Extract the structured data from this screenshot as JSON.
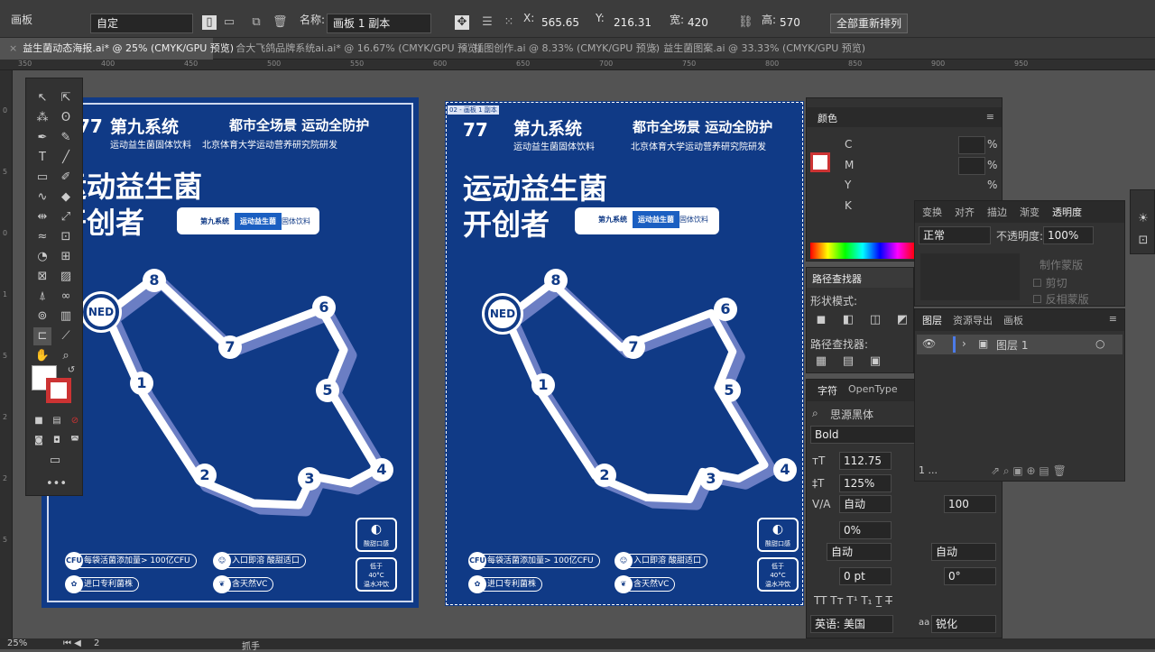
{
  "control": {
    "artboard_label": "画板",
    "preset": "自定",
    "name_label": "名称:",
    "name_value": "画板 1 副本",
    "x_label": "X:",
    "x_value": "565.65 m",
    "y_label": "Y:",
    "y_value": "216.31 m",
    "w_label": "宽:",
    "w_value": "420 mm",
    "h_label": "高:",
    "h_value": "570 mm",
    "rearrange_label": "全部重新排列"
  },
  "tabs": [
    {
      "label": "益生菌动态海报.ai* @ 25% (CMYK/GPU 预览)"
    },
    {
      "label": "合大飞鸽品牌系统ai.ai* @ 16.67% (CMYK/GPU 预览)"
    },
    {
      "label": "插图创作.ai @ 8.33% (CMYK/GPU 预览)"
    },
    {
      "label": "益生菌图案.ai @ 33.33% (CMYK/GPU 预览)"
    }
  ],
  "ruler": {
    "h": [
      "350",
      "400",
      "450",
      "500",
      "550",
      "600",
      "650",
      "700",
      "750",
      "800",
      "850",
      "900",
      "950"
    ],
    "v": [
      "0",
      "5",
      "0",
      "1",
      "5",
      "2",
      "2",
      "5"
    ]
  },
  "poster": {
    "brand": "第九系统",
    "brand_sub": "运动益生菌固体饮料",
    "slogan": "都市全场景 运动全防护",
    "slogan_sub": "北京体育大学运动营养研究院研发",
    "headline1": "运动益生菌",
    "headline2": "开创者",
    "pack_brand": "第九系统",
    "pack_mid": "运动益生菌",
    "pack_right": "固体饮料",
    "ned": "NED",
    "nodes": [
      "1",
      "2",
      "3",
      "4",
      "5",
      "6",
      "7",
      "8"
    ],
    "f1": "每袋活菌添加量> 100亿CFU",
    "f2": "入口即溶 酸甜适口",
    "f3": "进口专利菌株",
    "f4": "含天然VC",
    "cfu": "CFU",
    "b1": "酸甜口感",
    "b2a": "低于",
    "b2b": "40°C",
    "b2c": "温水冲饮",
    "artboard_tag": "02 - 画板 1 副本"
  },
  "color_panel": {
    "title": "颜色",
    "c": "C",
    "m": "M",
    "y": "Y",
    "k": "K",
    "pct": "%"
  },
  "pathfinder": {
    "title": "路径查找器",
    "shape_modes": "形状模式:",
    "finders": "路径查找器:"
  },
  "character": {
    "tab1": "字符",
    "tab2": "OpenType",
    "font": "思源黑体",
    "style": "Bold",
    "size": "112.75",
    "leading": "125%",
    "kerning": "自动",
    "tracking": "100",
    "tsume": "0%",
    "auto1": "自动",
    "auto2": "自动",
    "baseline": "0 pt",
    "rotate": "0°",
    "lang": "英语: 美国",
    "aa_label": "aa",
    "aa": "锐化"
  },
  "transparency": {
    "tabs": [
      "变换",
      "对齐",
      "描边",
      "渐变",
      "透明度"
    ],
    "mode": "正常",
    "opacity_label": "不透明度:",
    "opacity": "100%",
    "mask": "制作蒙版",
    "clip": "剪切",
    "invert": "反相蒙版"
  },
  "layers": {
    "tabs": [
      "图层",
      "资源导出",
      "画板"
    ],
    "layer_name": "图层 1",
    "count": "1 ..."
  },
  "status": {
    "zoom": "25%",
    "page": "2",
    "tool": "抓手"
  }
}
